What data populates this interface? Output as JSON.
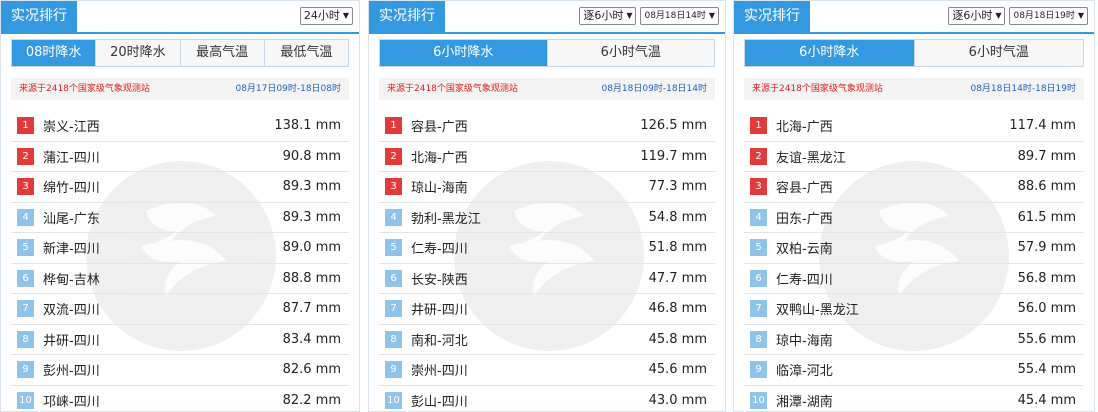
{
  "panels": [
    {
      "title": "实况排行",
      "selects": [
        "24小时"
      ],
      "tabs": [
        "08时降水",
        "20时降水",
        "最高气温",
        "最低气温"
      ],
      "active_tab": 0,
      "source": "来源于2418个国家级气象观测站",
      "period": "08月17日09时-18日08时",
      "rows": [
        {
          "rank": "1",
          "name": "崇义-江西",
          "value": "138.1 mm"
        },
        {
          "rank": "2",
          "name": "蒲江-四川",
          "value": "90.8 mm"
        },
        {
          "rank": "3",
          "name": "绵竹-四川",
          "value": "89.3 mm"
        },
        {
          "rank": "4",
          "name": "汕尾-广东",
          "value": "89.3 mm"
        },
        {
          "rank": "5",
          "name": "新津-四川",
          "value": "89.0 mm"
        },
        {
          "rank": "6",
          "name": "桦甸-吉林",
          "value": "88.8 mm"
        },
        {
          "rank": "7",
          "name": "双流-四川",
          "value": "87.7 mm"
        },
        {
          "rank": "8",
          "name": "井研-四川",
          "value": "83.4 mm"
        },
        {
          "rank": "9",
          "name": "彭州-四川",
          "value": "82.6 mm"
        },
        {
          "rank": "10",
          "name": "邛崃-四川",
          "value": "82.2 mm"
        }
      ]
    },
    {
      "title": "实况排行",
      "selects": [
        "逐6小时",
        "08月18日14时"
      ],
      "tabs": [
        "6小时降水",
        "6小时气温"
      ],
      "active_tab": 0,
      "source": "来源于2418个国家级气象观测站",
      "period": "08月18日09时-18日14时",
      "rows": [
        {
          "rank": "1",
          "name": "容县-广西",
          "value": "126.5 mm"
        },
        {
          "rank": "2",
          "name": "北海-广西",
          "value": "119.7 mm"
        },
        {
          "rank": "3",
          "name": "琼山-海南",
          "value": "77.3 mm"
        },
        {
          "rank": "4",
          "name": "勃利-黑龙江",
          "value": "54.8 mm"
        },
        {
          "rank": "5",
          "name": "仁寿-四川",
          "value": "51.8 mm"
        },
        {
          "rank": "6",
          "name": "长安-陕西",
          "value": "47.7 mm"
        },
        {
          "rank": "7",
          "name": "井研-四川",
          "value": "46.8 mm"
        },
        {
          "rank": "8",
          "name": "南和-河北",
          "value": "45.8 mm"
        },
        {
          "rank": "9",
          "name": "崇州-四川",
          "value": "45.6 mm"
        },
        {
          "rank": "10",
          "name": "彭山-四川",
          "value": "43.0 mm"
        }
      ]
    },
    {
      "title": "实况排行",
      "selects": [
        "逐6小时",
        "08月18日19时"
      ],
      "tabs": [
        "6小时降水",
        "6小时气温"
      ],
      "active_tab": 0,
      "source": "来源于2418个国家级气象观测站",
      "period": "08月18日14时-18日19时",
      "rows": [
        {
          "rank": "1",
          "name": "北海-广西",
          "value": "117.4 mm"
        },
        {
          "rank": "2",
          "name": "友谊-黑龙江",
          "value": "89.7 mm"
        },
        {
          "rank": "3",
          "name": "容县-广西",
          "value": "88.6 mm"
        },
        {
          "rank": "4",
          "name": "田东-广西",
          "value": "61.5 mm"
        },
        {
          "rank": "5",
          "name": "双柏-云南",
          "value": "57.9 mm"
        },
        {
          "rank": "6",
          "name": "仁寿-四川",
          "value": "56.8 mm"
        },
        {
          "rank": "7",
          "name": "双鸭山-黑龙江",
          "value": "56.0 mm"
        },
        {
          "rank": "8",
          "name": "琼中-海南",
          "value": "55.6 mm"
        },
        {
          "rank": "9",
          "name": "临漳-河北",
          "value": "55.4 mm"
        },
        {
          "rank": "10",
          "name": "湘潭-湖南",
          "value": "45.4 mm"
        }
      ]
    }
  ],
  "colors": {
    "accent": "#3399e0",
    "top_rank": "#e03a3a",
    "rank": "#8fc3ea",
    "source_text": "#e02020",
    "period_text": "#2060c0"
  },
  "icons": {
    "select": "chevron-down-icon",
    "watermark": "weather-logo-watermark-icon"
  }
}
